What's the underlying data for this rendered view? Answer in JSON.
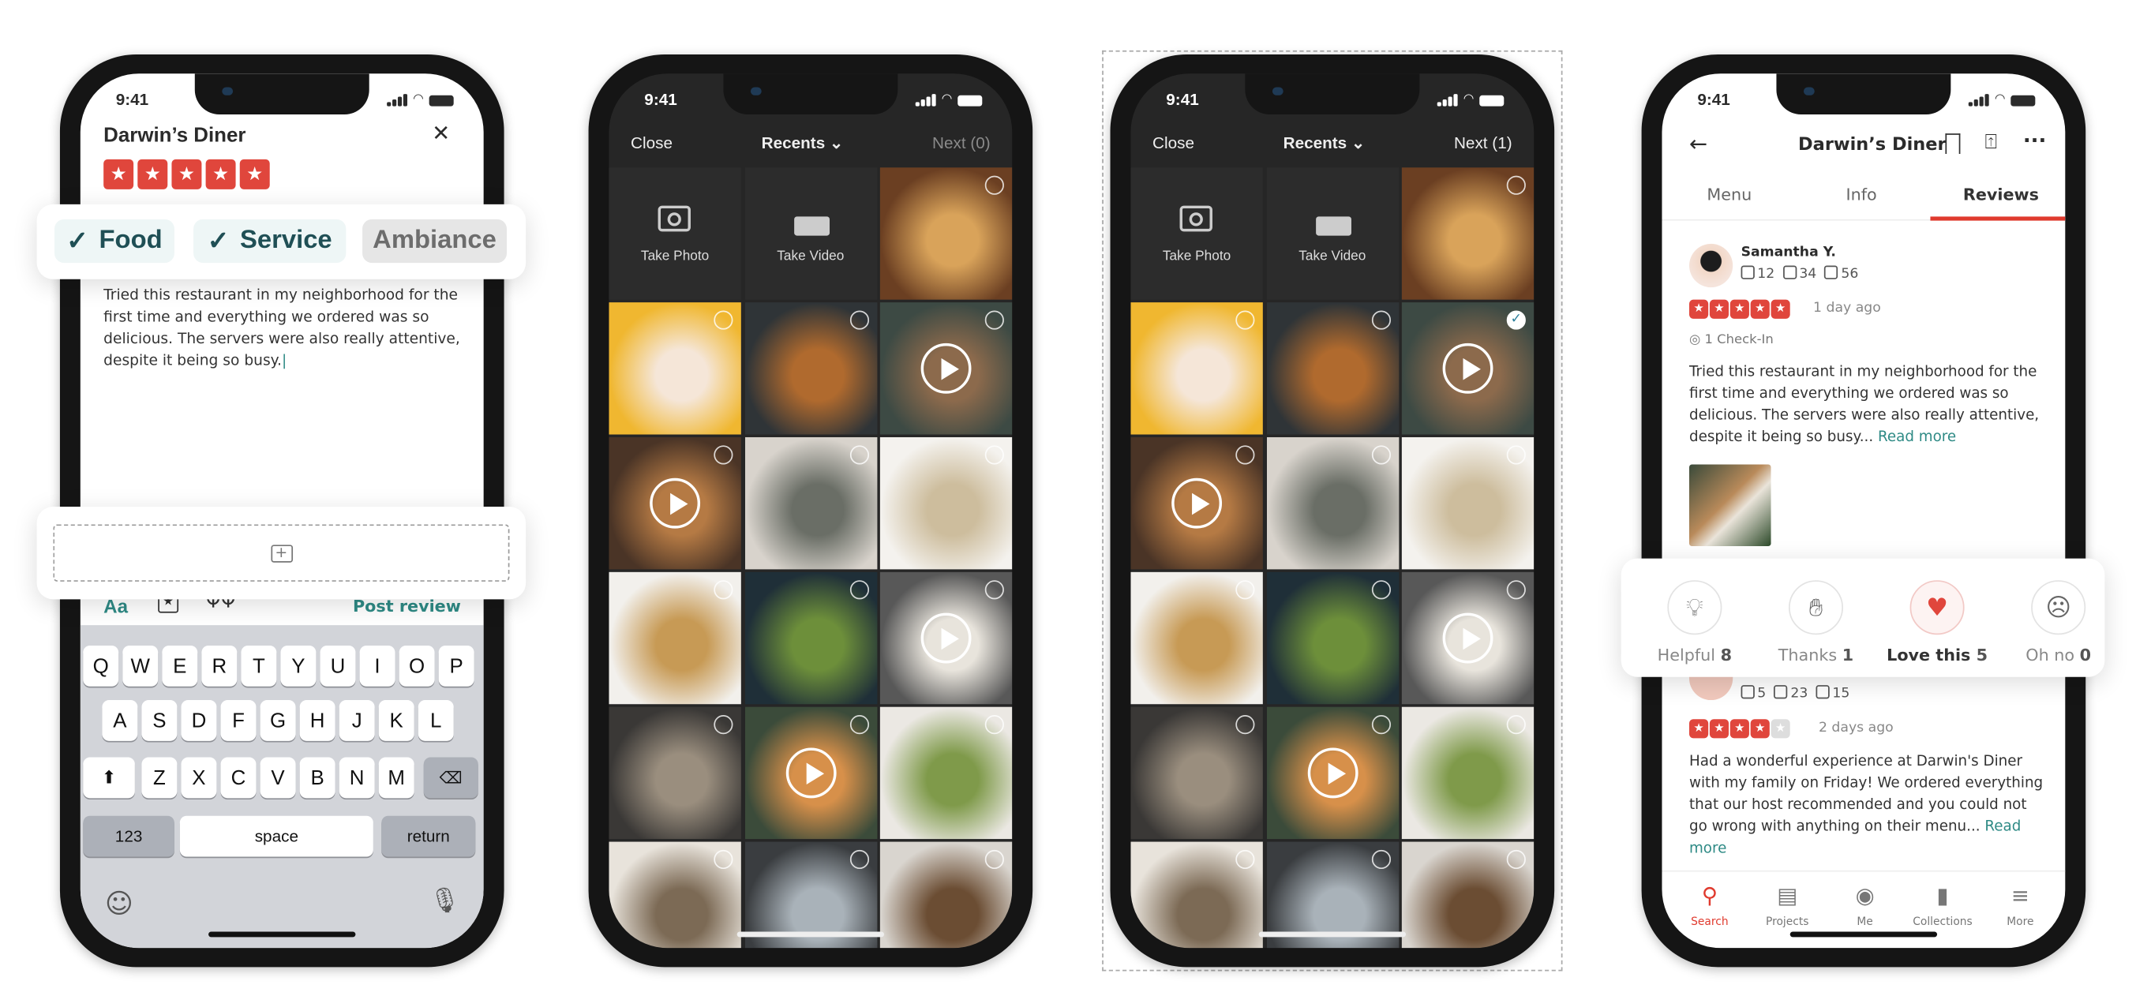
{
  "status_time": "9:41",
  "colors": {
    "star_red": "#e0463c",
    "teal": "#2e8a85",
    "tab_red": "#e03a2e",
    "dark_bg": "#262626"
  },
  "write_review": {
    "title": "Darwin’s Diner",
    "rating": 5,
    "chips": [
      {
        "label": "Food",
        "checked": true
      },
      {
        "label": "Service",
        "checked": true
      },
      {
        "label": "Ambiance",
        "checked": false
      }
    ],
    "text": "Tried this restaurant in my neighborhood for the first time and everything we ordered was so delicious. The servers were also really attentive, despite it being so busy.",
    "toolbar": {
      "format": "Aa",
      "post": "Post review"
    },
    "keyboard": {
      "rows": [
        [
          "Q",
          "W",
          "E",
          "R",
          "T",
          "Y",
          "U",
          "I",
          "O",
          "P"
        ],
        [
          "A",
          "S",
          "D",
          "F",
          "G",
          "H",
          "J",
          "K",
          "L"
        ],
        [
          "Z",
          "X",
          "C",
          "V",
          "B",
          "N",
          "M"
        ]
      ],
      "numbers": "123",
      "space": "space",
      "return": "return"
    }
  },
  "picker_before": {
    "close": "Close",
    "album": "Recents",
    "next": "Next (0)",
    "take_photo": "Take Photo",
    "take_video": "Take Video",
    "selected_tile": null
  },
  "picker_after": {
    "close": "Close",
    "album": "Recents",
    "next": "Next (1)",
    "take_photo": "Take Photo",
    "take_video": "Take Video",
    "selected_tile": 5
  },
  "tiles": [
    {
      "kind": "camera"
    },
    {
      "kind": "video-camera"
    },
    {
      "kind": "photo",
      "tone": [
        "#6b3f22",
        "#d9a35a"
      ]
    },
    {
      "kind": "photo",
      "tone": [
        "#f0b730",
        "#f5e6d8"
      ]
    },
    {
      "kind": "photo",
      "tone": [
        "#2f3437",
        "#b06a2e"
      ]
    },
    {
      "kind": "video",
      "tone": [
        "#3d4a44",
        "#8c6a4c"
      ]
    },
    {
      "kind": "video",
      "tone": [
        "#4a3426",
        "#b57a44"
      ]
    },
    {
      "kind": "photo",
      "tone": [
        "#d8d3cc",
        "#6a6e66"
      ]
    },
    {
      "kind": "photo",
      "tone": [
        "#f4f2ee",
        "#cdbd9d"
      ]
    },
    {
      "kind": "photo",
      "tone": [
        "#f2f0ec",
        "#c79a55"
      ]
    },
    {
      "kind": "photo",
      "tone": [
        "#1f2f38",
        "#6d8f3a"
      ]
    },
    {
      "kind": "video",
      "tone": [
        "#585858",
        "#e8e4dc"
      ]
    },
    {
      "kind": "photo",
      "tone": [
        "#3a3836",
        "#9a8e7e"
      ]
    },
    {
      "kind": "video",
      "tone": [
        "#3b4b3a",
        "#d7904a"
      ]
    },
    {
      "kind": "photo",
      "tone": [
        "#ebe8e3",
        "#7f9a4a"
      ]
    },
    {
      "kind": "photo",
      "tone": [
        "#e8e3db",
        "#7c6a55"
      ]
    },
    {
      "kind": "photo",
      "tone": [
        "#3a3d40",
        "#a9b2b9"
      ]
    },
    {
      "kind": "photo",
      "tone": [
        "#d9d5cf",
        "#6b4d33"
      ]
    }
  ],
  "reviews_screen": {
    "title": "Darwin’s Diner",
    "tabs": [
      "Menu",
      "Info",
      "Reviews"
    ],
    "active_tab": "Reviews",
    "review1": {
      "name": "Samantha Y.",
      "friends": "12",
      "reviews": "34",
      "photos": "56",
      "rating": 5,
      "date": "1 day ago",
      "checkin": "1 Check-In",
      "text": "Tried this restaurant in my neighborhood for the first time and everything we ordered was so delicious. The servers were also really attentive, despite it being so busy...",
      "read_more": "Read more"
    },
    "reactions": [
      {
        "label": "Helpful",
        "count": "8",
        "icon": "lightbulb-icon"
      },
      {
        "label": "Thanks",
        "count": "1",
        "icon": "clapping-hands-icon"
      },
      {
        "label": "Love this",
        "count": "5",
        "icon": "heart-icon",
        "active": true
      },
      {
        "label": "Oh no",
        "count": "0",
        "icon": "surprised-face-icon"
      }
    ],
    "review2": {
      "friends": "5",
      "reviews": "23",
      "photos": "15",
      "rating": 4,
      "date": "2 days ago",
      "text": "Had a wonderful experience at Darwin's Diner with my family on Friday! We ordered everything that our host recommended and you could not go wrong with anything on their menu...",
      "read_more": "Read more"
    },
    "nav": [
      {
        "label": "Search",
        "active": true
      },
      {
        "label": "Projects"
      },
      {
        "label": "Me"
      },
      {
        "label": "Collections"
      },
      {
        "label": "More"
      }
    ]
  }
}
